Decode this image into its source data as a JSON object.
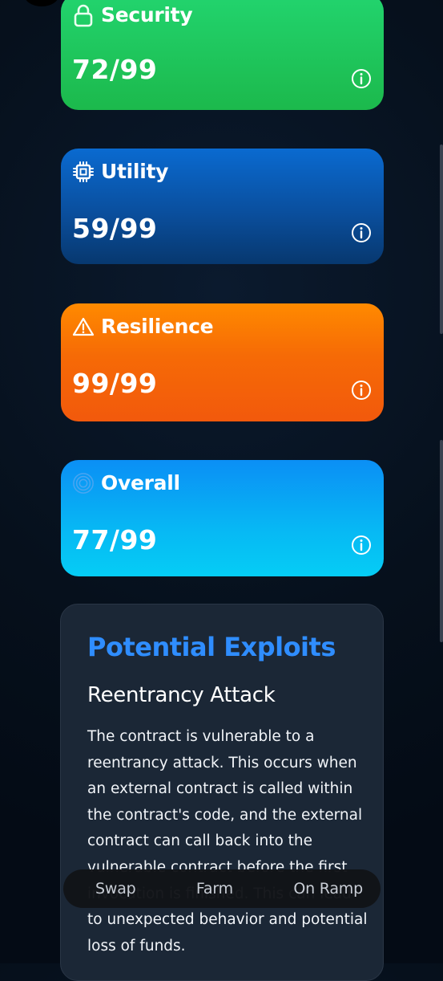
{
  "cards": [
    {
      "title": "Security",
      "score": "72/99",
      "icon": "lock-icon"
    },
    {
      "title": "Utility",
      "score": "59/99",
      "icon": "chip-icon"
    },
    {
      "title": "Resilience",
      "score": "99/99",
      "icon": "warning-icon"
    },
    {
      "title": "Overall",
      "score": "77/99",
      "icon": "target-icon"
    }
  ],
  "exploits": {
    "title": "Potential Exploits",
    "items": [
      {
        "name": "Reentrancy Attack",
        "description": "The contract is vulnerable to a reentrancy attack. This occurs when an external contract is called within the contract's code, and the external contract can call back into the vulnerable contract before the first invocation is finished. This can lead to unexpected behavior and potential loss of funds."
      }
    ]
  },
  "nav": {
    "items": [
      "Swap",
      "Farm",
      "On Ramp"
    ]
  },
  "colors": {
    "security": "#1fc75a",
    "utility": "#0a5ab5",
    "resilience": "#f66a06",
    "overall": "#07b4f4",
    "exploits_title": "#2f8dff",
    "panel": "#1b2736"
  }
}
